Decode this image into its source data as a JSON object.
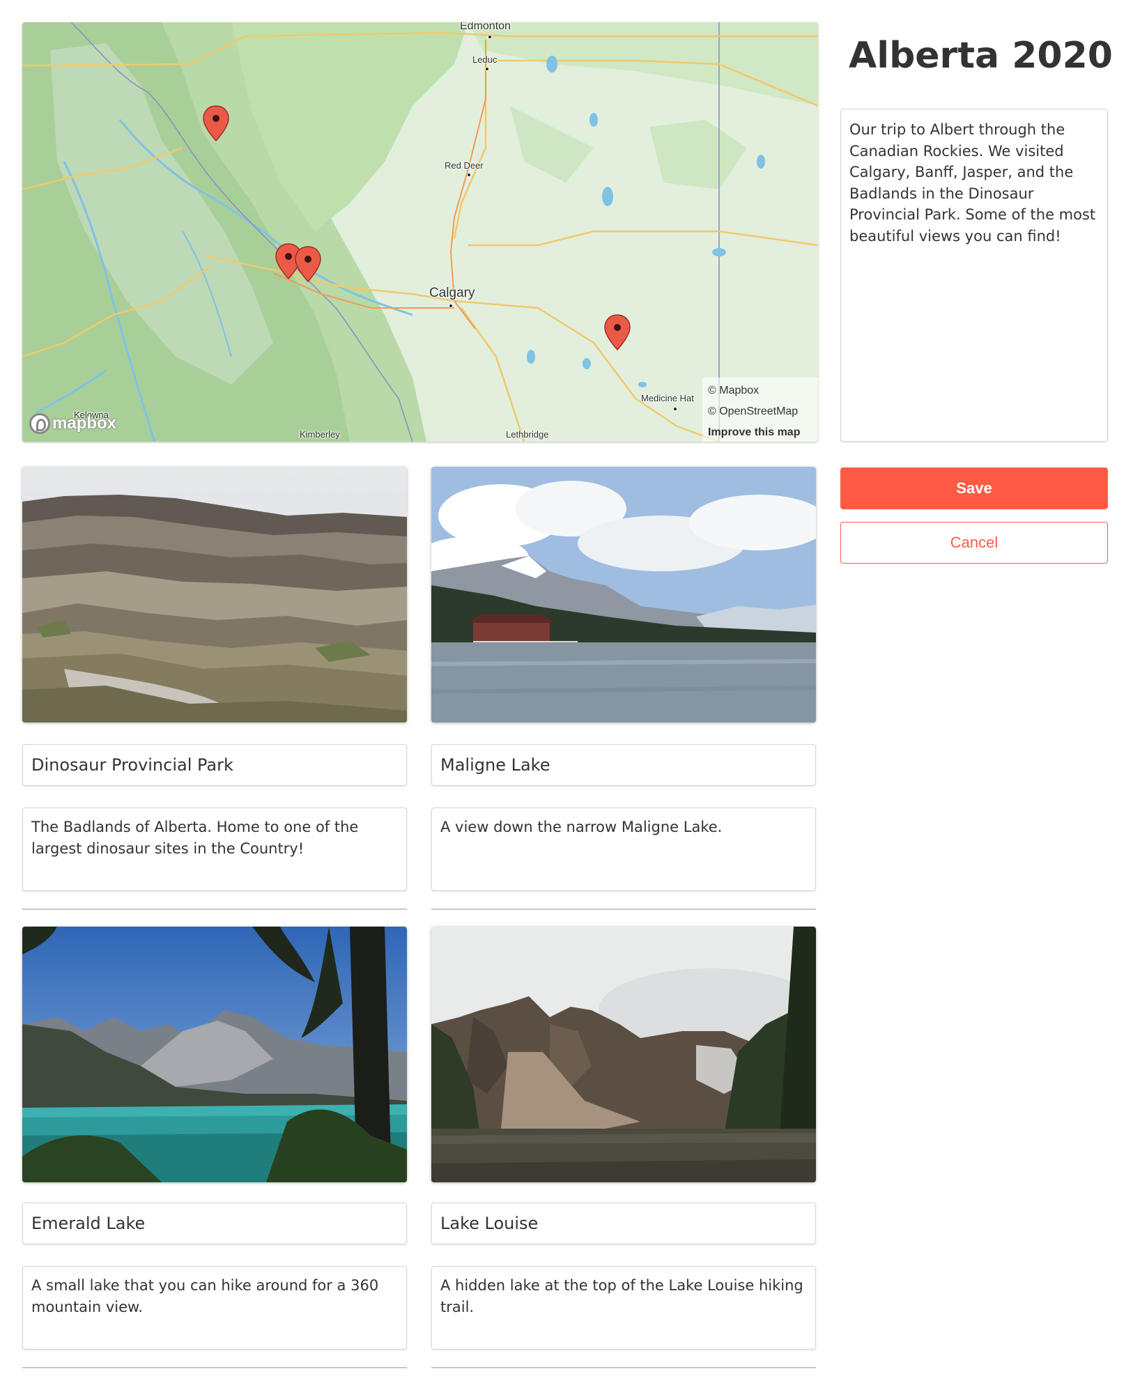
{
  "trip": {
    "title": "Alberta 2020",
    "description": "Our trip to Albert through the Canadian Rockies. We visited Calgary, Banff, Jasper, and the Badlands in the Dinosaur Provincial Park. Some of the most beautiful views you can find!"
  },
  "actions": {
    "save_label": "Save",
    "cancel_label": "Cancel"
  },
  "map": {
    "labels": {
      "edmonton": "Edmonton",
      "leduc": "Leduc",
      "red_deer": "Red Deer",
      "calgary": "Calgary",
      "medicine_hat": "Medicine Hat",
      "kelowna": "Kelowna",
      "kimberley": "Kimberley",
      "lethbridge": "Lethbridge"
    },
    "attribution": {
      "mapbox": "© Mapbox",
      "osm": "© OpenStreetMap",
      "improve": "Improve this map"
    },
    "logo_text": "mapbox",
    "marker_color": "#ea5a47",
    "marker_count": 4
  },
  "photos": [
    {
      "name": "Dinosaur Provincial Park",
      "description": "The Badlands of Alberta. Home to one of the largest dinosaur sites in the Country!"
    },
    {
      "name": "Maligne Lake",
      "description": "A view down the narrow Maligne Lake."
    },
    {
      "name": "Emerald Lake",
      "description": "A small lake that you can hike around for a 360 mountain view."
    },
    {
      "name": "Lake Louise",
      "description": "A hidden lake at the top of the Lake Louise hiking trail."
    }
  ],
  "colors": {
    "accent": "#ff5a45",
    "text": "#333333",
    "border": "#d6d6d6"
  }
}
